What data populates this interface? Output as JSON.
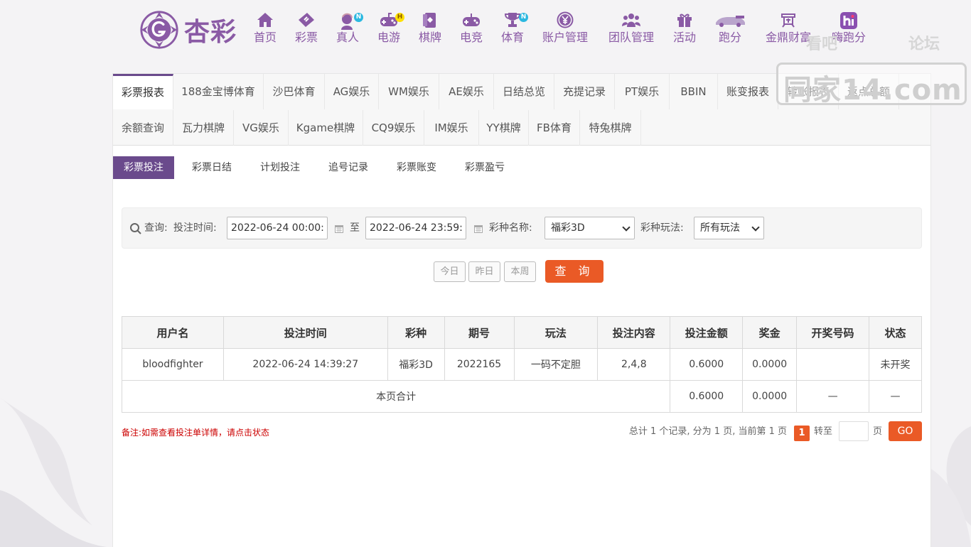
{
  "brand": {
    "logo_text": "杏彩",
    "accent": "#8a5aa5",
    "highlight": "#ea5a26"
  },
  "nav": [
    {
      "label": "首页",
      "icon": "home-icon",
      "badge": ""
    },
    {
      "label": "彩票",
      "icon": "ticket-icon",
      "badge": ""
    },
    {
      "label": "真人",
      "icon": "dealer-icon",
      "badge": "N"
    },
    {
      "label": "电游",
      "icon": "gamepad-icon",
      "badge": "H"
    },
    {
      "label": "棋牌",
      "icon": "cards-icon",
      "badge": ""
    },
    {
      "label": "电竞",
      "icon": "esports-controller-icon",
      "badge": ""
    },
    {
      "label": "体育",
      "icon": "trophy-icon",
      "badge": "N"
    },
    {
      "label": "账户管理",
      "icon": "yen-coin-icon",
      "badge": ""
    },
    {
      "label": "团队管理",
      "icon": "team-icon",
      "badge": ""
    },
    {
      "label": "活动",
      "icon": "gift-icon",
      "badge": ""
    },
    {
      "label": "跑分",
      "icon": "sports-car-icon",
      "badge": ""
    },
    {
      "label": "金鼎财富",
      "icon": "wealth-icon",
      "badge": ""
    },
    {
      "label": "嗨跑分",
      "icon": "hi-app-icon",
      "badge": ""
    }
  ],
  "watermark": {
    "line1": "看吧",
    "line2": "论坛",
    "domain": "同家14.com"
  },
  "tabs": [
    "彩票报表",
    "188金宝博体育",
    "沙巴体育",
    "AG娱乐",
    "WM娱乐",
    "AE娱乐",
    "日结总览",
    "充提记录",
    "PT娱乐",
    "BBIN",
    "账变报表",
    "转账报表",
    "返点总额",
    "余额查询",
    "瓦力棋牌",
    "VG娱乐",
    "Kgame棋牌",
    "CQ9娱乐",
    "IM娱乐",
    "YY棋牌",
    "FB体育",
    "特兔棋牌"
  ],
  "subtabs": [
    "彩票投注",
    "彩票日结",
    "计划投注",
    "追号记录",
    "彩票账变",
    "彩票盈亏"
  ],
  "search": {
    "query_label": "查询:",
    "time_label": "投注时间:",
    "start_time": "2022-06-24 00:00:00",
    "to_label": "至",
    "end_time": "2022-06-24 23:59:59",
    "lottery_label": "彩种名称:",
    "lottery_value": "福彩3D",
    "play_label": "彩种玩法:",
    "play_value": "所有玩法",
    "today": "今日",
    "yesterday": "昨日",
    "this_week": "本周",
    "submit": "查 询"
  },
  "table": {
    "headers": [
      "用户名",
      "投注时间",
      "彩种",
      "期号",
      "玩法",
      "投注内容",
      "投注金额",
      "奖金",
      "开奖号码",
      "状态"
    ],
    "rows": [
      [
        "bloodfighter",
        "2022-06-24 14:39:27",
        "福彩3D",
        "2022165",
        "一码不定胆",
        "2,4,8",
        "0.6000",
        "0.0000",
        "",
        "未开奖"
      ]
    ],
    "total": {
      "label": "本页合计",
      "amount": "0.6000",
      "bonus": "0.0000",
      "draw": "—",
      "status": "—"
    }
  },
  "note": "备注:如需查看投注单详情，请点击状态",
  "pager": {
    "summary": "总计 1 个记录, 分为 1 页, 当前第 1 页",
    "current": "1",
    "goto_label": "转至",
    "unit": "页",
    "go": "GO"
  }
}
